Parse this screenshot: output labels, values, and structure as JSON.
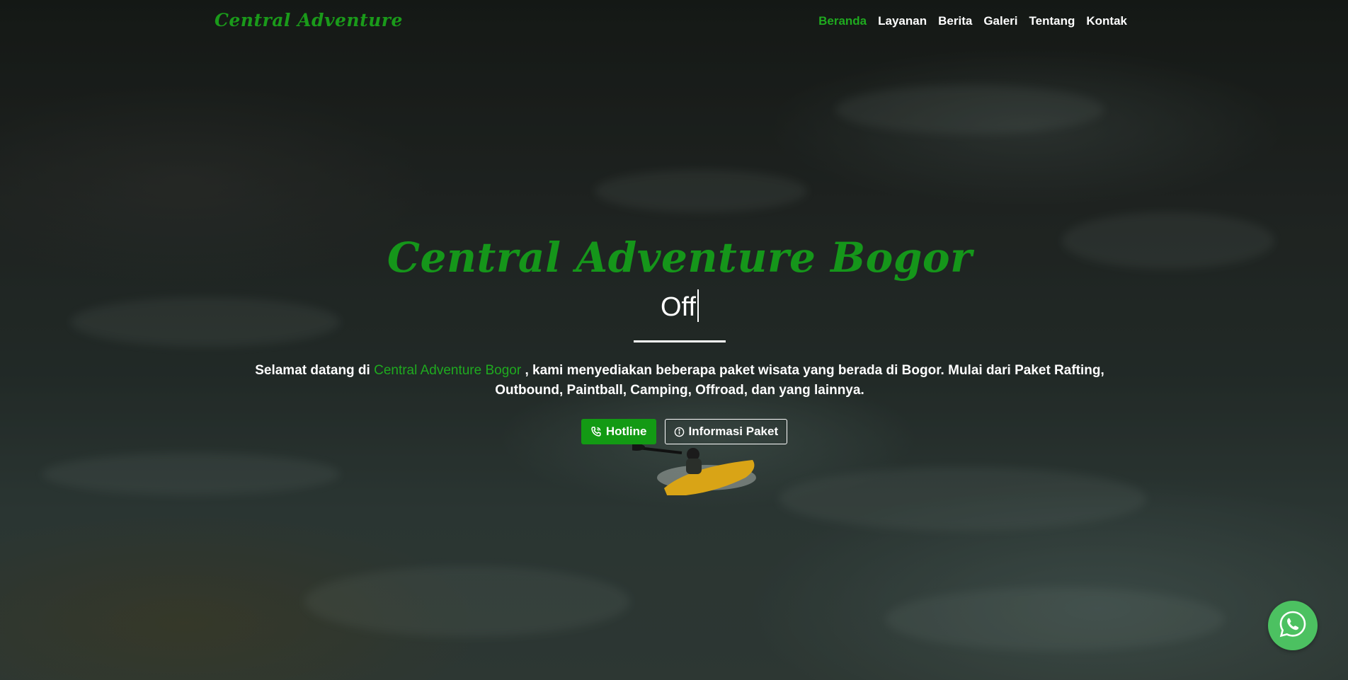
{
  "navbar": {
    "brand": "Central Adventure",
    "links": [
      {
        "label": "Beranda",
        "active": true
      },
      {
        "label": "Layanan",
        "active": false
      },
      {
        "label": "Berita",
        "active": false
      },
      {
        "label": "Galeri",
        "active": false
      },
      {
        "label": "Tentang",
        "active": false
      },
      {
        "label": "Kontak",
        "active": false
      }
    ]
  },
  "hero": {
    "title": "Central Adventure Bogor",
    "typed_text": "Off",
    "description_prefix": "Selamat datang di ",
    "description_highlight": "Central Adventure Bogor",
    "description_suffix": " , kami menyediakan beberapa paket wisata yang berada di Bogor. Mulai dari Paket Rafting, Outbound, Paintball, Camping, Offroad, dan yang lainnya.",
    "buttons": {
      "hotline_label": "Hotline",
      "info_label": "Informasi Paket"
    }
  },
  "icons": {
    "hotline": "phone-icon",
    "info": "info-circle-icon",
    "whatsapp": "whatsapp-icon"
  },
  "colors": {
    "accent_green": "#1faa1f",
    "button_green": "#139a14",
    "whatsapp_green": "#4cc161"
  }
}
